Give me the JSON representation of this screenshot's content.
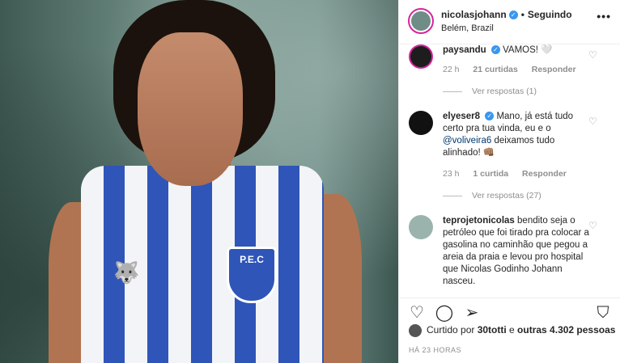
{
  "header": {
    "username": "nicolasjohann",
    "status": "Seguindo",
    "location": "Belém, Brazil",
    "more_label": "•••"
  },
  "photo": {
    "crest_text": "P.E.C"
  },
  "comments": [
    {
      "username": "paysandu",
      "text": "VAMOS! 🤍",
      "time": "22 h",
      "likes": "21 curtidas",
      "reply": "Responder",
      "view_replies": "Ver respostas (1)"
    },
    {
      "username": "elyeser8",
      "text_a": "Mano, já está tudo certo pra tua vinda, eu e o ",
      "mention": "@voliveira6",
      "text_b": " deixamos tudo alinhado! 👊🏽",
      "time": "23 h",
      "likes": "1 curtida",
      "reply": "Responder",
      "view_replies": "Ver respostas (27)"
    },
    {
      "username": "teprojetonicolas",
      "text": "bendito seja o petróleo que foi tirado pra colocar a gasolina no caminhão que pegou a areia da praia e levou pro hospital que Nicolas Godinho Johann nasceu."
    }
  ],
  "likes": {
    "prefix": "Curtido por ",
    "user": "30totti",
    "middle": " e ",
    "others": "outras 4.302 pessoas"
  },
  "timestamp": "HÁ 23 HORAS",
  "icons": [
    "heart-icon",
    "comment-icon",
    "share-icon",
    "bookmark-icon"
  ]
}
